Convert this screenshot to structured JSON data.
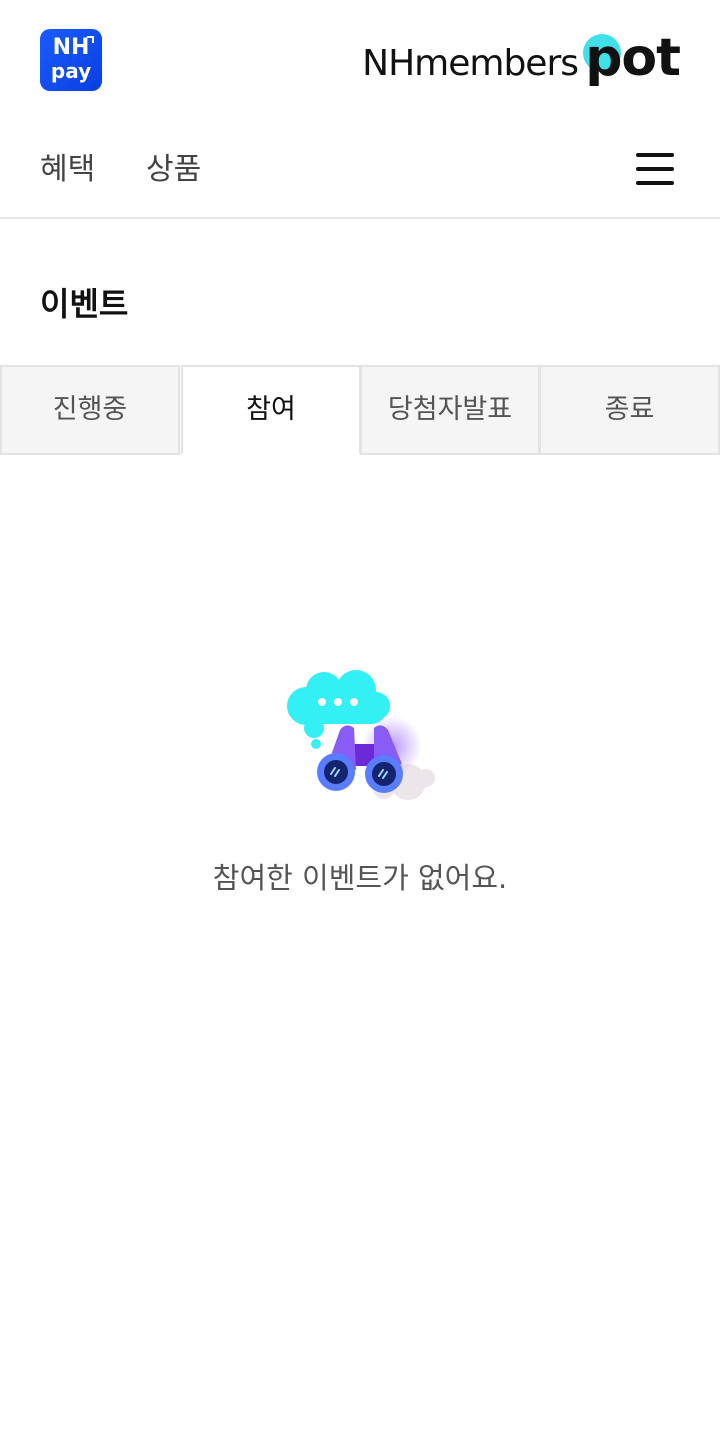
{
  "header": {
    "nhpay_logo": {
      "line1": "NH",
      "line2": "pay"
    },
    "brand_logo": {
      "members": "NHmembers",
      "pot": "pot"
    }
  },
  "nav": {
    "items": [
      {
        "label": "혜택"
      },
      {
        "label": "상품"
      }
    ]
  },
  "page_title": "이벤트",
  "tabs": [
    {
      "label": "진행중",
      "selected": false
    },
    {
      "label": "참여",
      "selected": true
    },
    {
      "label": "당첨자발표",
      "selected": false
    },
    {
      "label": "종료",
      "selected": false
    }
  ],
  "empty_state": {
    "message": "참여한 이벤트가 없어요.",
    "icon": "binoculars-thought-bubble-icon"
  },
  "colors": {
    "nhpay_blue": "#0a3fe0",
    "pot_cyan": "#3fe0e8",
    "binocular_purple": "#8a5cf6",
    "cloud_cyan": "#33f0f5"
  }
}
